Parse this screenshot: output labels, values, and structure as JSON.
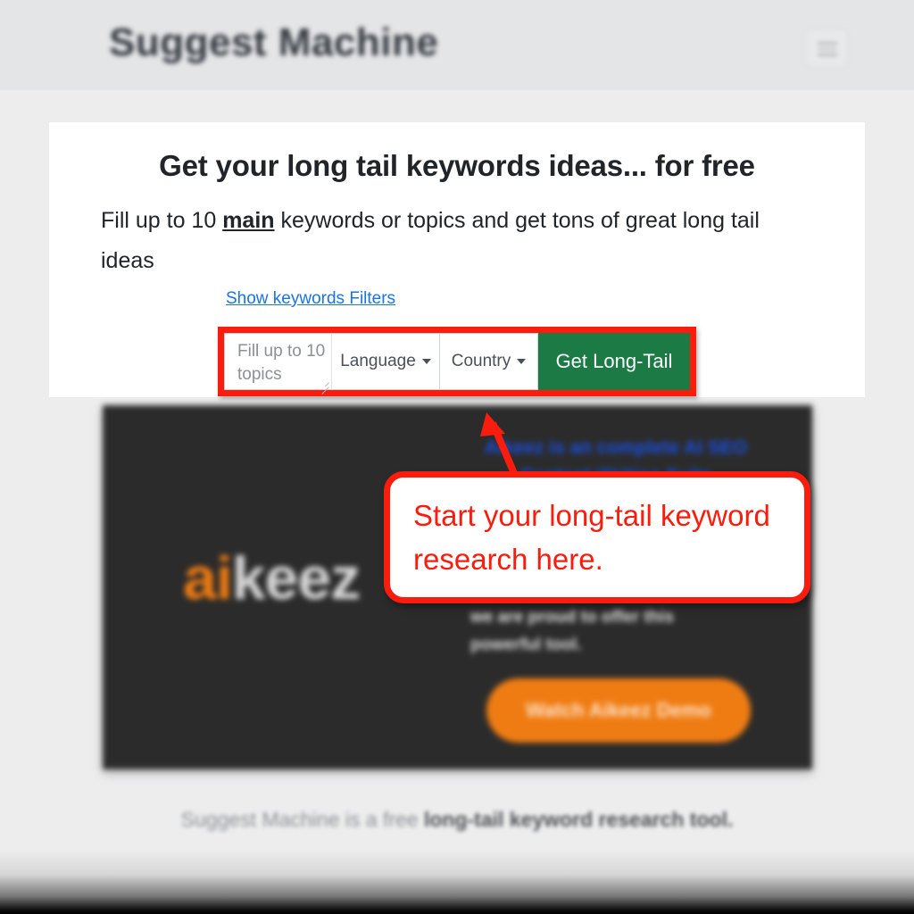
{
  "header": {
    "site_title": "Suggest Machine",
    "menu_toggle_label": "Toggle navigation"
  },
  "hero": {
    "title": "Get your long tail keywords ideas... for free",
    "subtitle_before": "Fill up to 10 ",
    "subtitle_emphasis": "main",
    "subtitle_after": " keywords or topics and get tons of great long tail ideas",
    "filters_link": "Show keywords Filters"
  },
  "form": {
    "topics_placeholder": "Fill up to 10 topics",
    "language_label": "Language",
    "country_label": "Country",
    "submit_label": "Get Long-Tail",
    "highlight_color": "#fa1c0c",
    "submit_color": "#1c7b45"
  },
  "promo": {
    "link_text": "Aikeez is an complete AI SEO Content Writing Suite",
    "body_text": "we are proud to offer this powerful tool.",
    "cta_label": "Watch Aikeez Demo",
    "logo_primary": "ai",
    "logo_secondary": "keez",
    "logo_primary_color": "#ef7c13",
    "logo_secondary_color": "#d6d6d6",
    "cta_color": "#ef7c13",
    "panel_color": "#2b2b2b"
  },
  "callout": {
    "text": "Start your long-tail keyword research here.",
    "color": "#fa1c0c"
  },
  "footer": {
    "tagline_before": "Suggest Machine is a free ",
    "tagline_bold": "long-tail keyword research tool."
  }
}
